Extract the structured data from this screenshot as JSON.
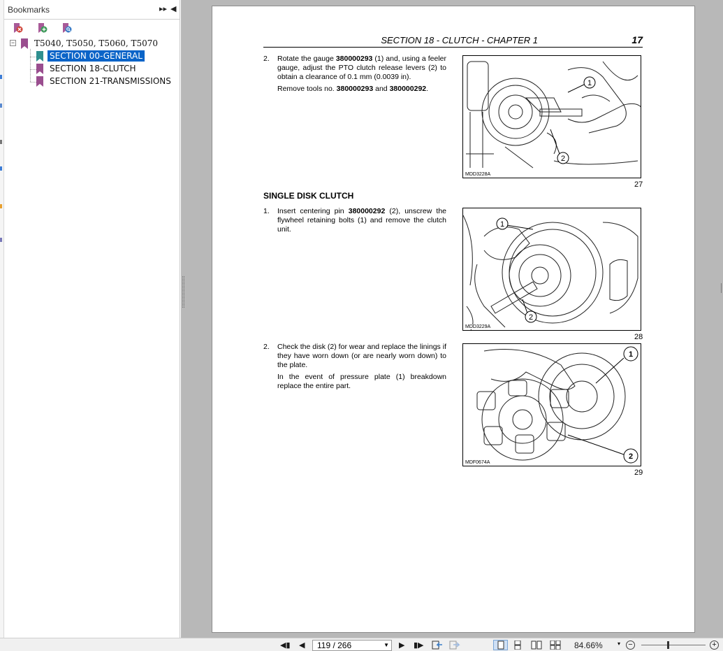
{
  "bookmarks_panel": {
    "title": "Bookmarks",
    "expand_icon": "double-chevron-right-icon",
    "collapse_icon": "chevron-left-icon",
    "toolbar": [
      "delete-bookmark-icon",
      "new-bookmark-icon",
      "find-bookmark-icon"
    ],
    "tree": {
      "root": {
        "label": "T5040, T5050, T5060, T5070",
        "toggle": "−"
      },
      "children": [
        {
          "label": "SECTION 00-GENERAL",
          "selected": true
        },
        {
          "label": "SECTION 18-CLUTCH",
          "selected": false
        },
        {
          "label": "SECTION 21-TRANSMISSIONS",
          "selected": false
        }
      ]
    }
  },
  "page": {
    "header": "SECTION 18 - CLUTCH - CHAPTER 1",
    "number": "17",
    "step_gauge": {
      "num": "2.",
      "text_a": "Rotate the gauge ",
      "bold_a": "380000293",
      "text_b": " (1) and, using a feeler gauge, adjust the PTO clutch release levers (2) to obtain a clearance of 0.1 mm (0.0039 in).",
      "remove_a": "Remove tools no. ",
      "remove_b1": "380000293",
      "remove_and": " and ",
      "remove_b2": "380000292",
      "remove_end": "."
    },
    "heading": "SINGLE DISK CLUTCH",
    "step_insert": {
      "num": "1.",
      "text_a": "Insert centering pin ",
      "bold_a": "380000292",
      "text_b": " (2), unscrew the flywheel retaining bolts (1) and remove the clutch unit."
    },
    "step_check": {
      "num": "2.",
      "text_a": "Check the disk (2) for wear and replace the linings if they have worn down (or are nearly worn down) to the plate.",
      "text_b": "In the event of pressure plate (1) breakdown replace the entire part."
    },
    "figures": [
      {
        "code": "MDD3228A",
        "number": "27",
        "callouts": [
          "1",
          "2"
        ]
      },
      {
        "code": "MDD3229A",
        "number": "28",
        "callouts": [
          "1",
          "2"
        ]
      },
      {
        "code": "MDF0674A",
        "number": "29",
        "callouts": [
          "1",
          "2"
        ]
      }
    ]
  },
  "bottom_bar": {
    "page_display": "119 / 266",
    "zoom": "84.66%",
    "zoom_dropdown": "▾",
    "zoom_level": 0.5,
    "nav_icons": [
      "first-page-icon",
      "prev-page-icon",
      "next-page-icon",
      "last-page-icon",
      "prev-view-icon",
      "next-view-icon"
    ],
    "view_icons": [
      "single-page-view-icon",
      "continuous-view-icon",
      "facing-view-icon",
      "continuous-facing-view-icon"
    ],
    "zoom_out": "−",
    "zoom_in": "+"
  },
  "colors": {
    "selection": "#0a64c8",
    "bookmark_flag": "#9a4e8f",
    "bookmark_flag_selected": "#2f8f8f",
    "doc_background": "#b8b8b8",
    "accent_red": "#e0433b"
  }
}
